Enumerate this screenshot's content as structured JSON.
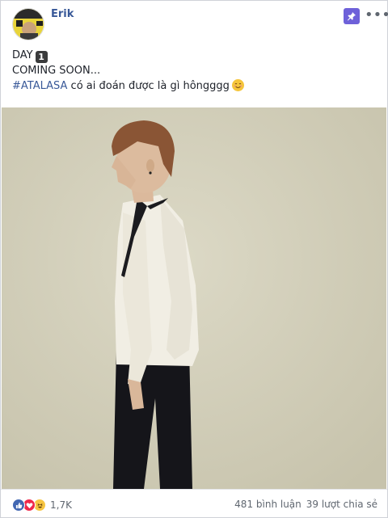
{
  "post": {
    "author": "Erik",
    "lines": {
      "day_label": "DAY",
      "day_number": "1",
      "coming_soon": "COMING SOON...",
      "hashtag": "#ATALASA",
      "question": " có ai đoán được là gì hôngggg"
    },
    "emoji": "smiling-face-emoji",
    "icons": {
      "pin": "pin-icon",
      "more": "more-options-icon"
    },
    "colors": {
      "author": "#385898",
      "pin_bg": "#6e61d9",
      "like": "#4267b2",
      "love": "#f0284a",
      "haha": "#f7c541"
    }
  },
  "footer": {
    "reactions": [
      "like",
      "love",
      "haha"
    ],
    "reaction_count": "1,7K",
    "comments": "481 bình luận",
    "shares": "39 lượt chia sẻ"
  }
}
